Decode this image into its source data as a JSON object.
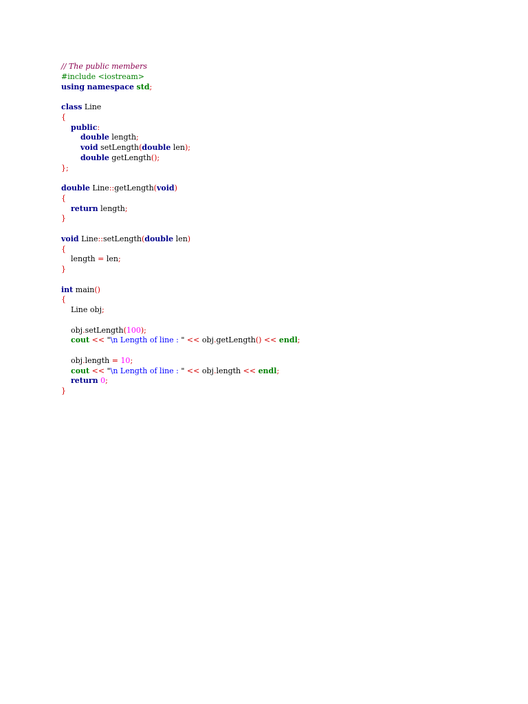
{
  "document": {
    "title": "// The public members",
    "code_lines": [
      [
        {
          "t": "// The public members",
          "c": "cm"
        }
      ],
      [
        {
          "t": "#include <iostream>",
          "c": "pp"
        }
      ],
      [
        {
          "t": "using",
          "c": "kw"
        },
        {
          "t": " ",
          "c": "tx"
        },
        {
          "t": "namespace",
          "c": "kw"
        },
        {
          "t": " ",
          "c": "tx"
        },
        {
          "t": "std",
          "c": "lib"
        },
        {
          "t": ";",
          "c": "op"
        }
      ],
      [],
      [
        {
          "t": "class",
          "c": "kw"
        },
        {
          "t": " Line",
          "c": "tx"
        }
      ],
      [
        {
          "t": "{",
          "c": "op"
        }
      ],
      [
        {
          "t": "    ",
          "c": "tx"
        },
        {
          "t": "public",
          "c": "kw"
        },
        {
          "t": ":",
          "c": "op"
        }
      ],
      [
        {
          "t": "        ",
          "c": "tx"
        },
        {
          "t": "double",
          "c": "kw"
        },
        {
          "t": " length",
          "c": "tx"
        },
        {
          "t": ";",
          "c": "op"
        }
      ],
      [
        {
          "t": "        ",
          "c": "tx"
        },
        {
          "t": "void",
          "c": "kw"
        },
        {
          "t": " setLength",
          "c": "tx"
        },
        {
          "t": "(",
          "c": "op"
        },
        {
          "t": "double",
          "c": "kw"
        },
        {
          "t": " len",
          "c": "tx"
        },
        {
          "t": ");",
          "c": "op"
        }
      ],
      [
        {
          "t": "        ",
          "c": "tx"
        },
        {
          "t": "double",
          "c": "kw"
        },
        {
          "t": " getLength",
          "c": "tx"
        },
        {
          "t": "();",
          "c": "op"
        }
      ],
      [
        {
          "t": "};",
          "c": "op"
        }
      ],
      [],
      [
        {
          "t": "double",
          "c": "kw"
        },
        {
          "t": " Line",
          "c": "tx"
        },
        {
          "t": "::",
          "c": "op"
        },
        {
          "t": "getLength",
          "c": "tx"
        },
        {
          "t": "(",
          "c": "op"
        },
        {
          "t": "void",
          "c": "kw"
        },
        {
          "t": ")",
          "c": "op"
        }
      ],
      [
        {
          "t": "{",
          "c": "op"
        }
      ],
      [
        {
          "t": "    ",
          "c": "tx"
        },
        {
          "t": "return",
          "c": "kw"
        },
        {
          "t": " length",
          "c": "tx"
        },
        {
          "t": ";",
          "c": "op"
        }
      ],
      [
        {
          "t": "}",
          "c": "op"
        }
      ],
      [],
      [
        {
          "t": "void",
          "c": "kw"
        },
        {
          "t": " Line",
          "c": "tx"
        },
        {
          "t": "::",
          "c": "op"
        },
        {
          "t": "setLength",
          "c": "tx"
        },
        {
          "t": "(",
          "c": "op"
        },
        {
          "t": "double",
          "c": "kw"
        },
        {
          "t": " len",
          "c": "tx"
        },
        {
          "t": ")",
          "c": "op"
        }
      ],
      [
        {
          "t": "{",
          "c": "op"
        }
      ],
      [
        {
          "t": "    length ",
          "c": "tx"
        },
        {
          "t": "=",
          "c": "op"
        },
        {
          "t": " len",
          "c": "tx"
        },
        {
          "t": ";",
          "c": "op"
        }
      ],
      [
        {
          "t": "}",
          "c": "op"
        }
      ],
      [],
      [
        {
          "t": "int",
          "c": "kw"
        },
        {
          "t": " main",
          "c": "tx"
        },
        {
          "t": "()",
          "c": "op"
        }
      ],
      [
        {
          "t": "{",
          "c": "op"
        }
      ],
      [
        {
          "t": "    Line obj",
          "c": "tx"
        },
        {
          "t": ";",
          "c": "op"
        }
      ],
      [],
      [
        {
          "t": "    obj",
          "c": "tx"
        },
        {
          "t": ".",
          "c": "op"
        },
        {
          "t": "setLength",
          "c": "tx"
        },
        {
          "t": "(",
          "c": "op"
        },
        {
          "t": "100",
          "c": "num"
        },
        {
          "t": ");",
          "c": "op"
        }
      ],
      [
        {
          "t": "    ",
          "c": "tx"
        },
        {
          "t": "cout",
          "c": "lib"
        },
        {
          "t": " << ",
          "c": "op"
        },
        {
          "t": "\"",
          "c": "tx"
        },
        {
          "t": "\\n Length of line : ",
          "c": "str"
        },
        {
          "t": "\"",
          "c": "tx"
        },
        {
          "t": " << ",
          "c": "op"
        },
        {
          "t": "obj",
          "c": "tx"
        },
        {
          "t": ".",
          "c": "op"
        },
        {
          "t": "getLength",
          "c": "tx"
        },
        {
          "t": "()",
          "c": "op"
        },
        {
          "t": " << ",
          "c": "op"
        },
        {
          "t": "endl",
          "c": "lib"
        },
        {
          "t": ";",
          "c": "op"
        }
      ],
      [],
      [
        {
          "t": "    obj",
          "c": "tx"
        },
        {
          "t": ".",
          "c": "op"
        },
        {
          "t": "length ",
          "c": "tx"
        },
        {
          "t": "=",
          "c": "op"
        },
        {
          "t": " ",
          "c": "tx"
        },
        {
          "t": "10",
          "c": "num"
        },
        {
          "t": ";",
          "c": "op"
        }
      ],
      [
        {
          "t": "    ",
          "c": "tx"
        },
        {
          "t": "cout",
          "c": "lib"
        },
        {
          "t": " << ",
          "c": "op"
        },
        {
          "t": "\"",
          "c": "tx"
        },
        {
          "t": "\\n Length of line : ",
          "c": "str"
        },
        {
          "t": "\"",
          "c": "tx"
        },
        {
          "t": " << ",
          "c": "op"
        },
        {
          "t": "obj",
          "c": "tx"
        },
        {
          "t": ".",
          "c": "op"
        },
        {
          "t": "length",
          "c": "tx"
        },
        {
          "t": " << ",
          "c": "op"
        },
        {
          "t": "endl",
          "c": "lib"
        },
        {
          "t": ";",
          "c": "op"
        }
      ],
      [
        {
          "t": "    ",
          "c": "tx"
        },
        {
          "t": "return",
          "c": "kw"
        },
        {
          "t": " ",
          "c": "tx"
        },
        {
          "t": "0",
          "c": "num"
        },
        {
          "t": ";",
          "c": "op"
        }
      ],
      [
        {
          "t": "}",
          "c": "op"
        }
      ]
    ]
  },
  "colors": {
    "background": "#ffffff",
    "keyword": "#00008b",
    "comment": "#8b0050",
    "preprocessor": "#008000",
    "operator": "#d40000",
    "number": "#ff00ff",
    "string": "#0000ff",
    "library": "#008000",
    "text": "#000000"
  }
}
